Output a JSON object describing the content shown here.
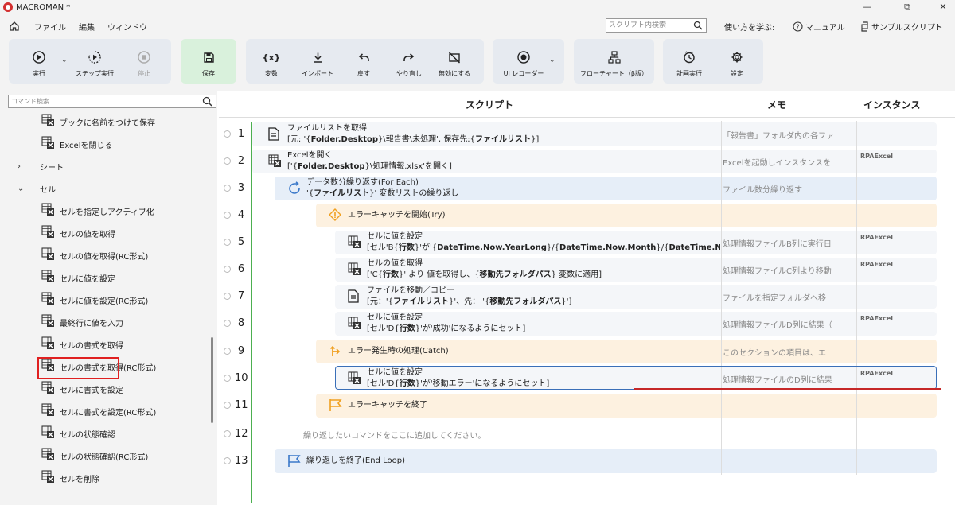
{
  "titlebar": {
    "title": "MACROMAN *",
    "minimize": "—",
    "restore": "⧉",
    "close": "✕"
  },
  "menu": {
    "file": "ファイル",
    "edit": "編集",
    "window": "ウィンドウ"
  },
  "search": {
    "placeholder": "スクリプト内検索"
  },
  "learn_label": "使い方を学ぶ:",
  "manual_label": "マニュアル",
  "sample_label": "サンプルスクリプト",
  "toolbar": {
    "run": "実行",
    "step": "ステップ実行",
    "stop": "停止",
    "save": "保存",
    "variables": "変数",
    "import": "インポート",
    "undo": "戻す",
    "redo": "やり直し",
    "disable": "無効にする",
    "recorder": "UI レコーダー",
    "flowchart": "フローチャート（β版）",
    "schedule": "計画実行",
    "settings": "設定"
  },
  "sidebar": {
    "search_placeholder": "コマンド検索",
    "items": [
      {
        "label": "ブックに名前をつけて保存"
      },
      {
        "label": "Excelを閉じる"
      },
      {
        "label": "シート"
      },
      {
        "label": "セル"
      },
      {
        "label": "セルを指定しアクティブ化"
      },
      {
        "label": "セルの値を取得"
      },
      {
        "label": "セルの値を取得(RC形式)"
      },
      {
        "label": "セルに値を設定"
      },
      {
        "label": "セルに値を設定(RC形式)"
      },
      {
        "label": "最終行に値を入力"
      },
      {
        "label": "セルの書式を取得"
      },
      {
        "label": "セルの書式を取得(RC形式)"
      },
      {
        "label": "セルに書式を設定"
      },
      {
        "label": "セルに書式を設定(RC形式)"
      },
      {
        "label": "セルの状態確認"
      },
      {
        "label": "セルの状態確認(RC形式)"
      },
      {
        "label": "セルを削除"
      }
    ]
  },
  "columns": {
    "script": "スクリプト",
    "memo": "メモ",
    "instance": "インスタンス"
  },
  "rows": [
    {
      "num": "1",
      "line1": "ファイルリストを取得",
      "l2a": "[元: '{",
      "l2b": "Folder.Desktop",
      "l2c": "}\\報告書\\未処理', 保存先:{",
      "l2d": "ファイルリスト",
      "l2e": "}]",
      "memo": "「報告書」フォルダ内の各ファ",
      "instance": ""
    },
    {
      "num": "2",
      "line1": "Excelを開く",
      "l2a": "['{",
      "l2b": "Folder.Desktop",
      "l2c": "}\\処理情報.xlsx'を開く]",
      "memo": "Excelを起動しインスタンスを",
      "instance": "RPAExcel"
    },
    {
      "num": "3",
      "line1": "データ数分繰り返す(For Each)",
      "l2a": "'{",
      "l2b": "ファイルリスト",
      "l2c": "}' 変数リストの繰り返し",
      "memo": "ファイル数分繰り返す",
      "instance": ""
    },
    {
      "num": "4",
      "line1": "エラーキャッチを開始(Try)",
      "memo": "",
      "instance": ""
    },
    {
      "num": "5",
      "line1": "セルに値を設定",
      "l2a": "[セル'B{",
      "l2b": "行数",
      "l2c": "}'が'{",
      "l2d": "DateTime.Now.YearLong",
      "l2e": "}/{",
      "l2f": "DateTime.Now.Month",
      "l2g": "}/{",
      "l2h": "DateTime.Now",
      "memo": "処理情報ファイルB列に実行日",
      "instance": "RPAExcel"
    },
    {
      "num": "6",
      "line1": "セルの値を取得",
      "l2a": "['C{",
      "l2b": "行数",
      "l2c": "}' より 値を取得し、{",
      "l2d": "移動先フォルダパス",
      "l2e": "} 変数に適用]",
      "memo": "処理情報ファイルC列より移動",
      "instance": "RPAExcel"
    },
    {
      "num": "7",
      "line1": "ファイルを移動／コピー",
      "l2a": "[元：'{",
      "l2b": "ファイルリスト",
      "l2c": "}'、先： '{",
      "l2d": "移動先フォルダパス",
      "l2e": "}']",
      "memo": "ファイルを指定フォルダへ移",
      "instance": ""
    },
    {
      "num": "8",
      "line1": "セルに値を設定",
      "l2a": "[セル'D{",
      "l2b": "行数",
      "l2c": "}'が'成功'になるようにセット]",
      "memo": "処理情報ファイルD列に結果（",
      "instance": "RPAExcel"
    },
    {
      "num": "9",
      "line1": "エラー発生時の処理(Catch)",
      "memo": "このセクションの項目は、エ",
      "instance": ""
    },
    {
      "num": "10",
      "line1": "セルに値を設定",
      "l2a": "[セル'D{",
      "l2b": "行数",
      "l2c": "}'が'移動エラー'になるようにセット]",
      "memo": "処理情報ファイルのD列に結果",
      "instance": "RPAExcel"
    },
    {
      "num": "11",
      "line1": "エラーキャッチを終了",
      "memo": "",
      "instance": ""
    },
    {
      "num": "12",
      "line1": "",
      "memo": "",
      "instance": ""
    },
    {
      "num": "13",
      "line1": "繰り返しを終了(End Loop)",
      "memo": "",
      "instance": ""
    }
  ],
  "add_hint": "繰り返したいコマンドをここに追加してください。"
}
